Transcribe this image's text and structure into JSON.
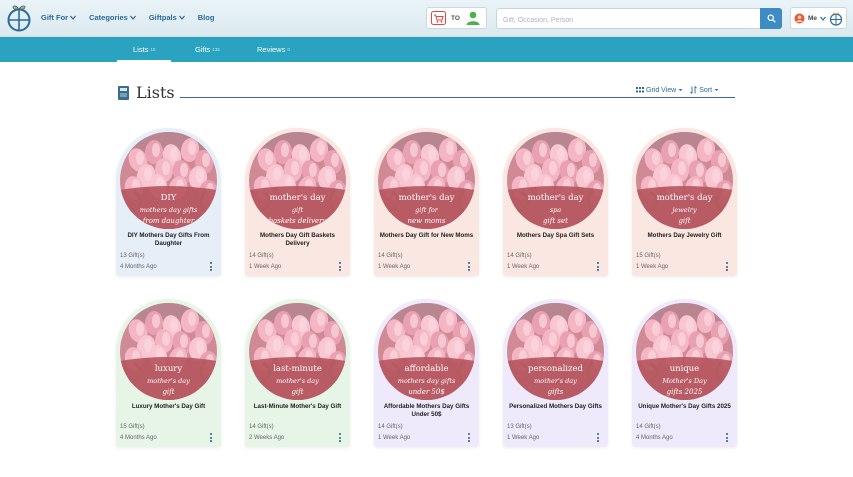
{
  "header": {
    "nav": [
      {
        "label": "Gift For",
        "dropdown": true
      },
      {
        "label": "Categories",
        "dropdown": true
      },
      {
        "label": "Giftpals",
        "dropdown": true
      },
      {
        "label": "Blog",
        "dropdown": false
      }
    ],
    "to_label": "TO",
    "search_placeholder": "Gift, Occasion, Person",
    "me_label": "Me"
  },
  "tabs": [
    {
      "label": "Lists",
      "count": "10",
      "active": true
    },
    {
      "label": "Gifts",
      "count": "135",
      "active": false
    },
    {
      "label": "Reviews",
      "count": "0",
      "active": false
    }
  ],
  "page": {
    "title": "Lists",
    "view_label": "Grid View",
    "sort_label": "Sort"
  },
  "colors": {
    "tabbar": "#2aa3c0",
    "link": "#2a6b9c",
    "image_band": "#b7575f"
  },
  "lists": [
    {
      "title": "DIY Mothers Day Gifts From Daughter",
      "count": "13 Gift(s)",
      "time": "4 Months Ago",
      "bg": "#e6eef8",
      "overlay": [
        "DIY",
        "mothers day gifts",
        "from daughter"
      ]
    },
    {
      "title": "Mothers Day Gift Baskets Delivery",
      "count": "14 Gift(s)",
      "time": "1 Week Ago",
      "bg": "#fbe7e2",
      "overlay": [
        "mother's day",
        "gift",
        "baskets delivery"
      ]
    },
    {
      "title": "Mothers Day Gift for New Moms",
      "count": "14 Gift(s)",
      "time": "1 Week Ago",
      "bg": "#fbe7e2",
      "overlay": [
        "mother's day",
        "gift for",
        "new moms"
      ]
    },
    {
      "title": "Mothers Day Spa Gift Sets",
      "count": "14 Gift(s)",
      "time": "1 Week Ago",
      "bg": "#fbe7e2",
      "overlay": [
        "mother's day",
        "spa",
        "gift set"
      ]
    },
    {
      "title": "Mothers Day Jewelry Gift",
      "count": "15 Gift(s)",
      "time": "1 Week Ago",
      "bg": "#fbe7e2",
      "overlay": [
        "mother's day",
        "jewelry",
        "gift"
      ]
    },
    {
      "title": "Luxury Mother's Day Gift",
      "count": "15 Gift(s)",
      "time": "4 Months Ago",
      "bg": "#e6f5e6",
      "overlay": [
        "luxury",
        "mother's day",
        "gift"
      ]
    },
    {
      "title": "Last-Minute Mother's Day Gift",
      "count": "14 Gift(s)",
      "time": "2 Weeks Ago",
      "bg": "#e6f5e6",
      "overlay": [
        "last-minute",
        "mother's day",
        "gift"
      ]
    },
    {
      "title": "Affordable Mothers Day Gifts Under 50$",
      "count": "14 Gift(s)",
      "time": "1 Week Ago",
      "bg": "#eeeafb",
      "overlay": [
        "affordable",
        "mothers day gifts",
        "under 50$"
      ]
    },
    {
      "title": "Personalized Mothers Day Gifts",
      "count": "13 Gift(s)",
      "time": "1 Week Ago",
      "bg": "#eeeafb",
      "overlay": [
        "personalized",
        "mother's day",
        "gifts"
      ]
    },
    {
      "title": "Unique Mother's Day Gifts 2025",
      "count": "14 Gift(s)",
      "time": "4 Months Ago",
      "bg": "#eeeafb",
      "overlay": [
        "unique",
        "Mother's Day",
        "gifts 2025"
      ]
    }
  ]
}
